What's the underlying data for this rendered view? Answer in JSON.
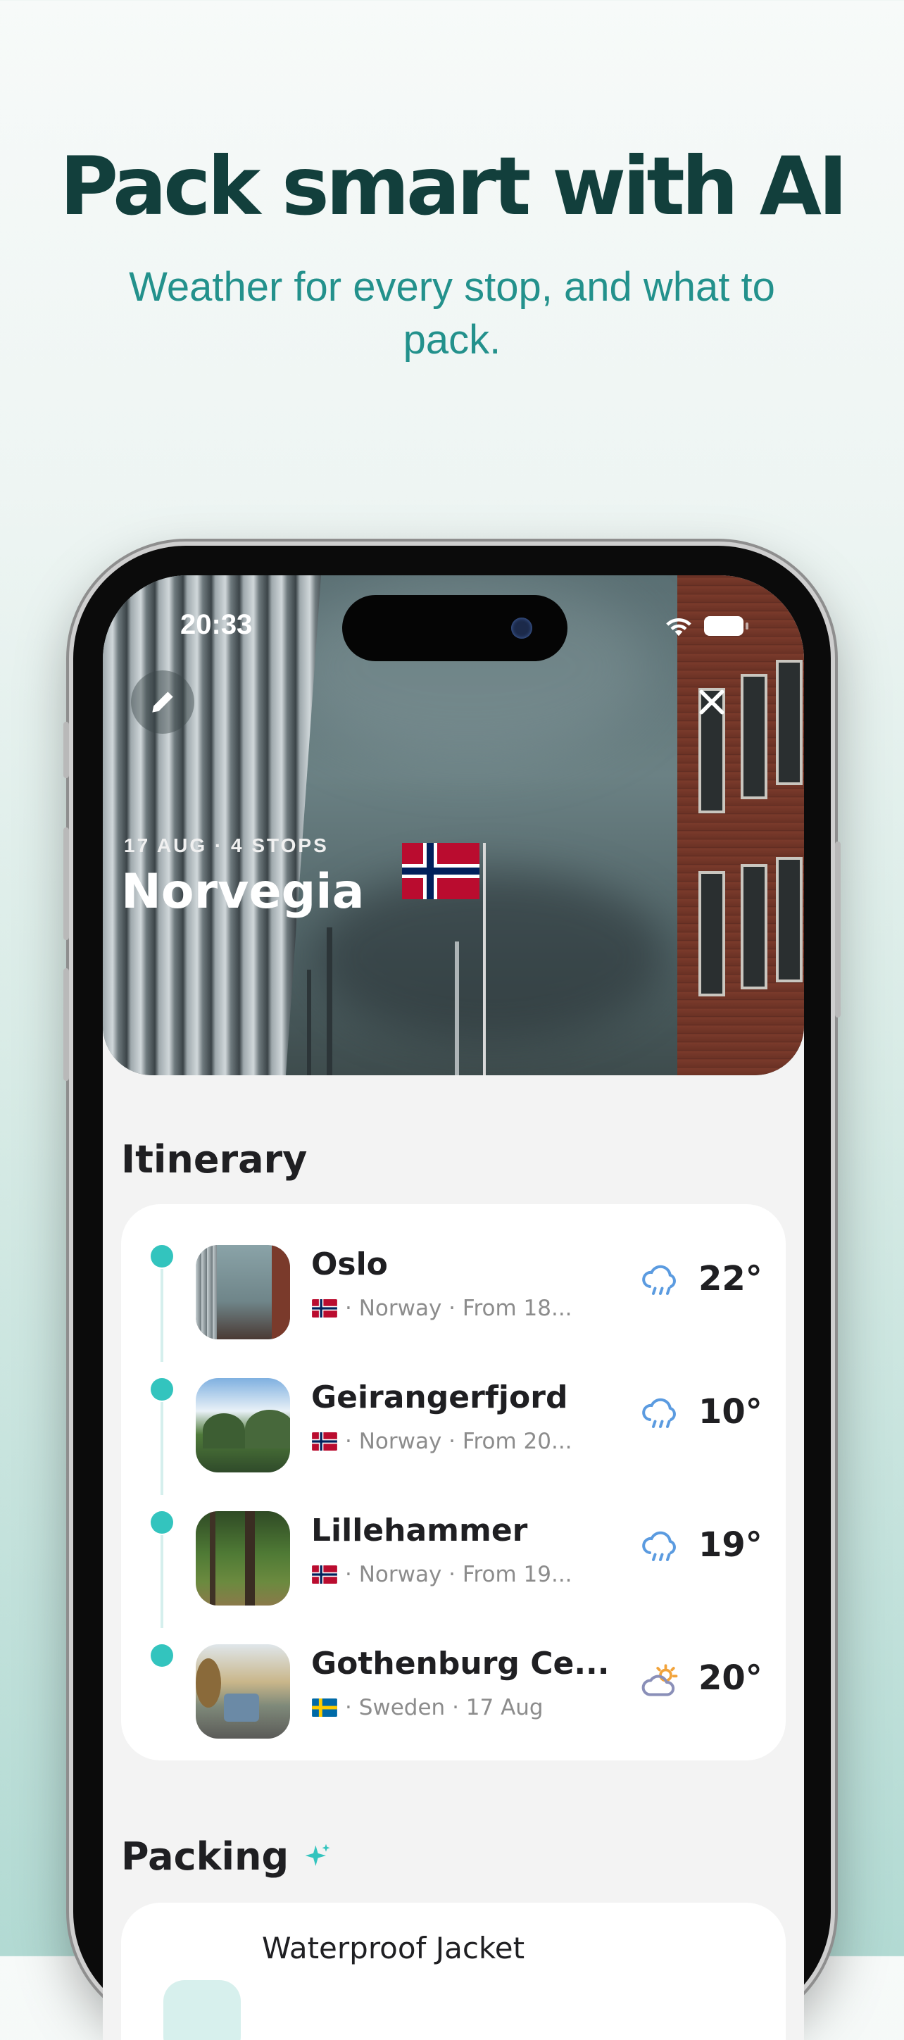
{
  "headline": "Pack smart with AI",
  "subline": "Weather for every stop, and what to pack.",
  "status_bar": {
    "time": "20:33"
  },
  "trip": {
    "meta": "17 AUG · 4 STOPS",
    "title": "Norvegia"
  },
  "itinerary": {
    "title": "Itinerary",
    "stops": [
      {
        "name": "Oslo",
        "detail": "· Norway · From 18...",
        "temp": "22°",
        "weather_icon": "rain-cloud-icon",
        "flag": "norway"
      },
      {
        "name": "Geirangerfjord",
        "detail": "· Norway · From 20...",
        "temp": "10°",
        "weather_icon": "rain-cloud-icon",
        "flag": "norway"
      },
      {
        "name": "Lillehammer",
        "detail": "· Norway · From 19...",
        "temp": "19°",
        "weather_icon": "rain-cloud-icon",
        "flag": "norway"
      },
      {
        "name": "Gothenburg Ce...",
        "detail": "· Sweden · 17 Aug",
        "temp": "20°",
        "weather_icon": "partly-sunny-icon",
        "flag": "sweden"
      }
    ]
  },
  "packing": {
    "title": "Packing",
    "items": [
      {
        "label": "Waterproof Jacket"
      }
    ]
  },
  "colors": {
    "accent": "#33c4be",
    "headline": "#123f3c",
    "subline": "#23918c"
  }
}
